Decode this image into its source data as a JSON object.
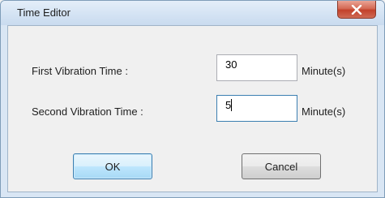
{
  "window": {
    "title": "Time Editor",
    "close_icon": "close-x-icon"
  },
  "fields": [
    {
      "label": "First Vibration Time :",
      "value": "30",
      "unit": "Minute(s)"
    },
    {
      "label": "Second Vibration Time :",
      "value": "5",
      "unit": "Minute(s)"
    }
  ],
  "buttons": {
    "ok_label": "OK",
    "cancel_label": "Cancel"
  },
  "colors": {
    "close_button": "#c2412b",
    "ok_border": "#3c7fb1",
    "dialog_background": "#f0f0f0"
  }
}
